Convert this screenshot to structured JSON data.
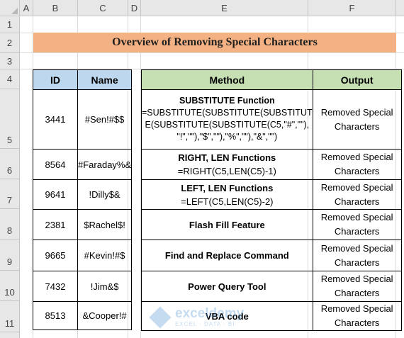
{
  "columns": [
    "A",
    "B",
    "C",
    "D",
    "E",
    "F"
  ],
  "rows": [
    "1",
    "2",
    "3",
    "4",
    "5",
    "6",
    "7",
    "8",
    "9",
    "10",
    "11"
  ],
  "title": "Overview of Removing Special Characters",
  "left_table": {
    "headers": [
      "ID",
      "Name"
    ],
    "rows": [
      {
        "id": "3441",
        "name": "#Sen!#$$"
      },
      {
        "id": "8564",
        "name": "#Faraday%&"
      },
      {
        "id": "9641",
        "name": "!Dilly$&"
      },
      {
        "id": "2381",
        "name": "$Rachel$!"
      },
      {
        "id": "9665",
        "name": "#Kevin!#$"
      },
      {
        "id": "7432",
        "name": "!Jim&$"
      },
      {
        "id": "8513",
        "name": "&Cooper!#"
      }
    ]
  },
  "right_table": {
    "headers": [
      "Method",
      "Output"
    ],
    "rows": [
      {
        "method": "SUBSTITUTE Function",
        "formula_lines": [
          "=SUBSTITUTE(SUBSTITUTE(SUBSTITUT",
          "E(SUBSTITUTE(SUBSTITUTE(C5,\"#\",\"\"),",
          "\"!\",\"\"),\"$\",\"\"),\"%\",\"\"),\"&\",\"\")"
        ],
        "output_lines": [
          "Removed Special",
          "Characters"
        ]
      },
      {
        "method": "RIGHT, LEN Functions",
        "formula_lines": [
          "=RIGHT(C5,LEN(C5)-1)"
        ],
        "output_lines": [
          "Removed Special",
          "Characters"
        ]
      },
      {
        "method": "LEFT, LEN Functions",
        "formula_lines": [
          "=LEFT(C5,LEN(C5)-2)"
        ],
        "output_lines": [
          "Removed Special",
          "Characters"
        ]
      },
      {
        "method": "Flash Fill Feature",
        "formula_lines": [],
        "output_lines": [
          "Removed Special",
          "Characters"
        ]
      },
      {
        "method": "Find and Replace Command",
        "formula_lines": [],
        "output_lines": [
          "Removed Special",
          "Characters"
        ]
      },
      {
        "method": "Power Query Tool",
        "formula_lines": [],
        "output_lines": [
          "Removed Special",
          "Characters"
        ]
      },
      {
        "method": "VBA code",
        "formula_lines": [],
        "output_lines": [
          "Removed Special",
          "Characters"
        ]
      }
    ]
  },
  "watermark": {
    "name": "exceldemy",
    "tagline": "EXCEL · DATA · BI"
  },
  "colors": {
    "title_band": "#f4b183",
    "left_header": "#bdd7ee",
    "right_header": "#c6e0b4",
    "header_bg": "#e7e7e7"
  }
}
